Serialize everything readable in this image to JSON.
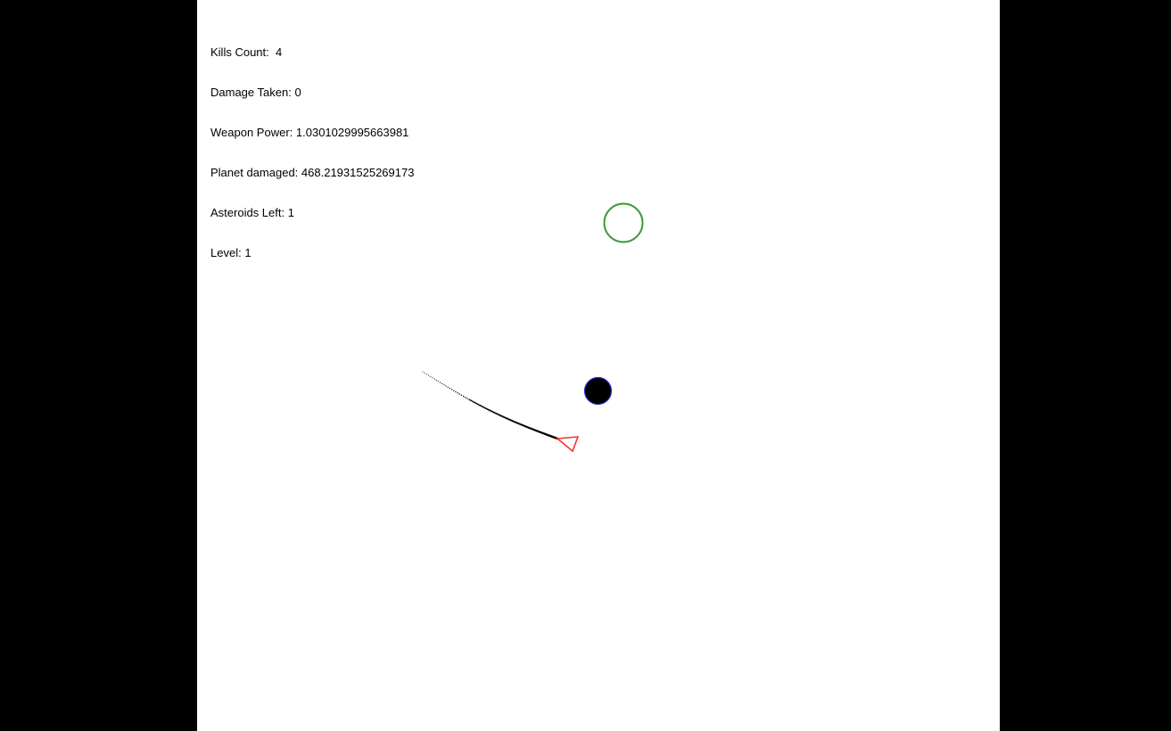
{
  "hud": {
    "kills_label": "Kills Count:",
    "kills_value": "4",
    "damage_label": "Damage Taken:",
    "damage_value": "0",
    "weapon_label": "Weapon Power:",
    "weapon_value": "1.0301029995663981",
    "planet_label": "Planet damaged:",
    "planet_value": "468.21931525269173",
    "asteroids_label": "Asteroids Left:",
    "asteroids_value": "1",
    "level_label": "Level:",
    "level_value": "1"
  },
  "colors": {
    "side_bars": "#000000",
    "canvas_bg": "#ffffff",
    "hud_text": "#000000",
    "asteroid_outline": "#3a9a3a",
    "planet_fill": "#000000",
    "planet_outline": "#2a2ad0",
    "ship_outline": "#ff3030",
    "trail": "#000000"
  },
  "objects": {
    "asteroid": "green-ring-asteroid",
    "planet": "black-planet",
    "ship": "red-triangle-ship",
    "trail": "ship-exhaust-trail"
  }
}
